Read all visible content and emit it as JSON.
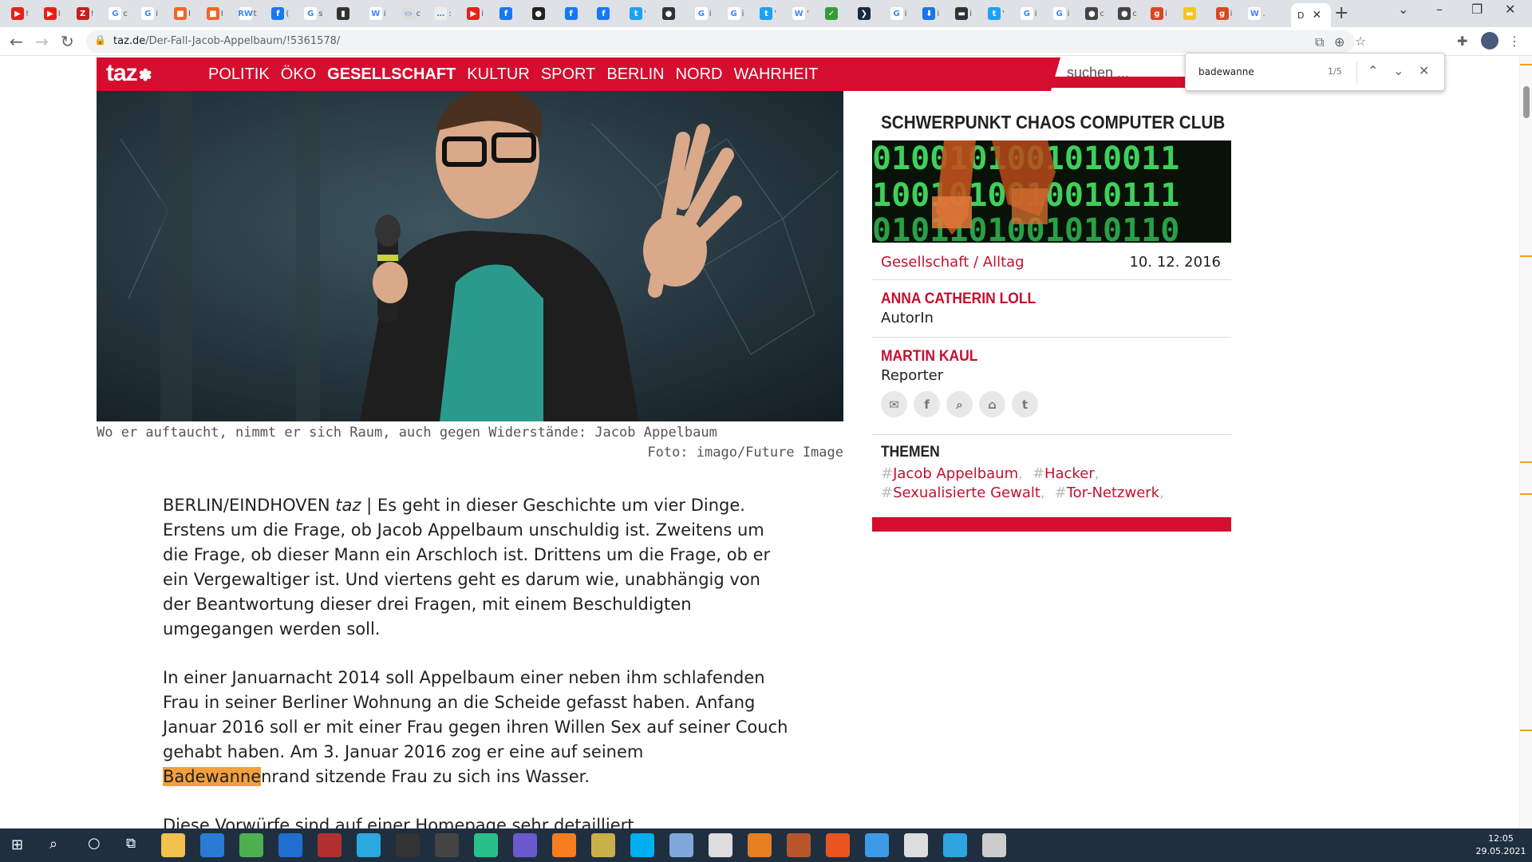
{
  "browser": {
    "active_tab_label": "D",
    "tabs": [
      {
        "icon": "youtube-icon",
        "color": "#e62117",
        "glyph": "▶",
        "suffix": "!"
      },
      {
        "icon": "youtube-icon",
        "color": "#e62117",
        "glyph": "▶",
        "suffix": "I"
      },
      {
        "icon": "z-icon",
        "color": "#c41e1e",
        "glyph": "Z",
        "suffix": "!"
      },
      {
        "icon": "google-icon",
        "color": "#ffffff",
        "glyph": "G",
        "suffix": "c"
      },
      {
        "icon": "google-icon",
        "color": "#ffffff",
        "glyph": "G",
        "suffix": "i"
      },
      {
        "icon": "feed-icon",
        "color": "#f26522",
        "glyph": "■",
        "suffix": "I"
      },
      {
        "icon": "feed-icon",
        "color": "#f26522",
        "glyph": "■",
        "suffix": "I"
      },
      {
        "icon": "rw-icon",
        "color": "#ffffff",
        "glyph": "RW",
        "suffix": "t"
      },
      {
        "icon": "facebook-icon",
        "color": "#1877f2",
        "glyph": "f",
        "suffix": "("
      },
      {
        "icon": "google-icon",
        "color": "#ffffff",
        "glyph": "G",
        "suffix": "s"
      },
      {
        "icon": "bookmark-icon",
        "color": "#333333",
        "glyph": "▮",
        "suffix": ""
      },
      {
        "icon": "wikipedia-icon",
        "color": "#ffffff",
        "glyph": "W",
        "suffix": "i"
      },
      {
        "icon": "archive-icon",
        "color": "#dddddd",
        "glyph": "▭",
        "suffix": "c"
      },
      {
        "icon": "page-icon",
        "color": "#eeeeee",
        "glyph": "…",
        "suffix": ":"
      },
      {
        "icon": "youtube-icon",
        "color": "#e62117",
        "glyph": "▶",
        "suffix": "i"
      },
      {
        "icon": "facebook-icon",
        "color": "#1877f2",
        "glyph": "f",
        "suffix": ""
      },
      {
        "icon": "circle-icon",
        "color": "#222222",
        "glyph": "●",
        "suffix": ""
      },
      {
        "icon": "facebook-icon",
        "color": "#1877f2",
        "glyph": "f",
        "suffix": ""
      },
      {
        "icon": "facebook-icon",
        "color": "#1877f2",
        "glyph": "f",
        "suffix": ""
      },
      {
        "icon": "twitter-icon",
        "color": "#1da1f2",
        "glyph": "t",
        "suffix": "'"
      },
      {
        "icon": "github-icon",
        "color": "#333333",
        "glyph": "●",
        "suffix": ""
      },
      {
        "icon": "google-icon",
        "color": "#ffffff",
        "glyph": "G",
        "suffix": "i"
      },
      {
        "icon": "google-icon",
        "color": "#ffffff",
        "glyph": "G",
        "suffix": "i"
      },
      {
        "icon": "twitter-icon",
        "color": "#1da1f2",
        "glyph": "t",
        "suffix": "'"
      },
      {
        "icon": "wikipedia-icon",
        "color": "#ffffff",
        "glyph": "W",
        "suffix": "'"
      },
      {
        "icon": "leaf-icon",
        "color": "#3a9a3a",
        "glyph": "✓",
        "suffix": ""
      },
      {
        "icon": "arrow-icon",
        "color": "#1a2a3a",
        "glyph": "❯",
        "suffix": ""
      },
      {
        "icon": "google-icon",
        "color": "#ffffff",
        "glyph": "G",
        "suffix": "i"
      },
      {
        "icon": "download-icon",
        "color": "#1a73e8",
        "glyph": "⬇",
        "suffix": "i"
      },
      {
        "icon": "keyboard-icon",
        "color": "#333333",
        "glyph": "▬",
        "suffix": "i"
      },
      {
        "icon": "twitter-icon",
        "color": "#1da1f2",
        "glyph": "t",
        "suffix": "'"
      },
      {
        "icon": "google-icon",
        "color": "#ffffff",
        "glyph": "G",
        "suffix": "i"
      },
      {
        "icon": "google-icon",
        "color": "#ffffff",
        "glyph": "G",
        "suffix": "i"
      },
      {
        "icon": "ccc-icon",
        "color": "#444444",
        "glyph": "●",
        "suffix": "c"
      },
      {
        "icon": "ccc-icon",
        "color": "#444444",
        "glyph": "●",
        "suffix": "c"
      },
      {
        "icon": "g-orange-icon",
        "color": "#d9471e",
        "glyph": "g",
        "suffix": "i"
      },
      {
        "icon": "flag-icon",
        "color": "#f5c518",
        "glyph": "▬",
        "suffix": ""
      },
      {
        "icon": "g-orange-icon",
        "color": "#d9471e",
        "glyph": "g",
        "suffix": "i"
      },
      {
        "icon": "wikipedia-icon",
        "color": "#ffffff",
        "glyph": "W",
        "suffix": "."
      }
    ],
    "url_host": "taz.de",
    "url_path": "/Der-Fall-Jacob-Appelbaum/!5361578/"
  },
  "taz": {
    "logo": "taz",
    "nav": [
      "POLITIK",
      "ÖKO",
      "GESELLSCHAFT",
      "KULTUR",
      "SPORT",
      "BERLIN",
      "NORD",
      "WAHRHEIT"
    ],
    "active_nav": "GESELLSCHAFT",
    "search_placeholder": "suchen ..."
  },
  "find": {
    "query": "badewanne",
    "count": "1/5"
  },
  "article": {
    "caption": "Wo er auftaucht, nimmt er sich Raum, auch gegen Widerstände: Jacob Appelbaum",
    "credit": "Foto: imago/Future Image",
    "p1_dateline": "BERLIN/EINDHOVEN ",
    "p1_source": "taz",
    "p1_text": " | Es geht in dieser Geschichte um vier Dinge. Erstens um die Frage, ob Jacob Appelbaum unschuldig ist. Zweitens um die Frage, ob dieser Mann ein Arschloch ist. Drittens um die Frage, ob er ein Vergewaltiger ist. Und viertens geht es darum wie, unabhängig von der Beantwortung dieser drei Fragen, mit einem Beschuldigten umgegangen werden soll.",
    "p2_before": "In einer Januarnacht 2014 soll Appelbaum einer neben ihm schlafenden Frau in seiner Berliner Wohnung an die Scheide gefasst haben. Anfang Januar 2016 soll er mit einer Frau gegen ihren Willen Sex auf seiner Couch gehabt haben. Am 3. Januar 2016 zog er eine auf seinem ",
    "p2_highlight": "Badewanne",
    "p2_after": "nrand sitzende Frau zu sich ins Wasser.",
    "p3_text": "Diese Vorwürfe sind auf einer Homepage sehr detailliert"
  },
  "sidebar": {
    "title": "SCHWERPUNKT CHAOS COMPUTER CLUB",
    "binary_rows": [
      "0100101001010011",
      "1001010010010111",
      "0101101001010110"
    ],
    "rubric": "Gesellschaft / Alltag",
    "date": "10. 12. 2016",
    "authors": [
      {
        "name": "ANNA CATHERIN LOLL",
        "role": "AutorIn"
      },
      {
        "name": "MARTIN KAUL",
        "role": "Reporter"
      }
    ],
    "social": [
      {
        "icon": "email-icon",
        "glyph": "✉"
      },
      {
        "icon": "facebook-icon",
        "glyph": "f"
      },
      {
        "icon": "search-icon",
        "glyph": "⌕"
      },
      {
        "icon": "home-icon",
        "glyph": "⌂"
      },
      {
        "icon": "twitter-icon",
        "glyph": "t"
      }
    ],
    "themen_label": "THEMEN",
    "tags_row1": [
      "Jacob Appelbaum",
      "Hacker"
    ],
    "tags_row2": [
      "Sexualisierte Gewalt",
      "Tor-Netzwerk"
    ]
  },
  "taskbar": {
    "time": "12:05",
    "date": "29.05.2021",
    "apps": [
      {
        "icon": "file-explorer-icon",
        "color": "#f2c14e"
      },
      {
        "icon": "store-icon",
        "color": "#2a7bd4"
      },
      {
        "icon": "chrome-icon",
        "color": "#4caf50"
      },
      {
        "icon": "thunderbird-icon",
        "color": "#1f6fd0"
      },
      {
        "icon": "voicemeeter-icon",
        "color": "#b03030"
      },
      {
        "icon": "skype-like-icon",
        "color": "#2aa8e0"
      },
      {
        "icon": "obs-icon",
        "color": "#333333"
      },
      {
        "icon": "live-icon",
        "color": "#444444"
      },
      {
        "icon": "mixer-icon",
        "color": "#2ac08a"
      },
      {
        "icon": "visual-studio-icon",
        "color": "#6a5acd"
      },
      {
        "icon": "firefox-icon",
        "color": "#f57c1f"
      },
      {
        "icon": "pen-icon",
        "color": "#c9b04a"
      },
      {
        "icon": "skype-icon",
        "color": "#00aff0"
      },
      {
        "icon": "cube-icon",
        "color": "#7fa8d8"
      },
      {
        "icon": "notepad-icon",
        "color": "#dddddd"
      },
      {
        "icon": "audio-icon",
        "color": "#e67e22"
      },
      {
        "icon": "tools-icon",
        "color": "#b8562a"
      },
      {
        "icon": "ubuntu-icon",
        "color": "#e95420"
      },
      {
        "icon": "messenger-icon",
        "color": "#3c9be8"
      },
      {
        "icon": "notes-icon",
        "color": "#dddddd"
      },
      {
        "icon": "telegram-icon",
        "color": "#2ca5e0"
      },
      {
        "icon": "window-icon",
        "color": "#cccccc"
      }
    ]
  }
}
